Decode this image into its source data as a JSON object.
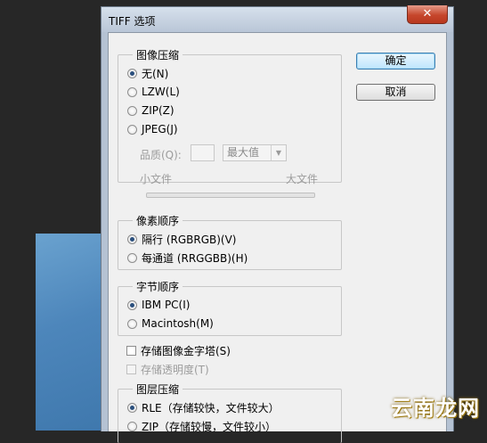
{
  "dialog": {
    "title": "TIFF 选项",
    "close_label": "✕"
  },
  "buttons": {
    "ok": "确定",
    "cancel": "取消"
  },
  "image_compression": {
    "label": "图像压缩",
    "options": [
      {
        "label": "无(N)",
        "selected": true
      },
      {
        "label": "LZW(L)",
        "selected": false
      },
      {
        "label": "ZIP(Z)",
        "selected": false
      },
      {
        "label": "JPEG(J)",
        "selected": false
      }
    ],
    "quality_label": "品质(Q):",
    "quality_value": "",
    "quality_select": "最大值",
    "small_file": "小文件",
    "large_file": "大文件"
  },
  "pixel_order": {
    "label": "像素顺序",
    "options": [
      {
        "label": "隔行 (RGBRGB)(V)",
        "selected": true
      },
      {
        "label": "每通道 (RRGGBB)(H)",
        "selected": false
      }
    ]
  },
  "byte_order": {
    "label": "字节顺序",
    "options": [
      {
        "label": "IBM PC(I)",
        "selected": true
      },
      {
        "label": "Macintosh(M)",
        "selected": false
      }
    ]
  },
  "checkboxes": {
    "pyramid": "存储图像金字塔(S)",
    "transparency": "存储透明度(T)"
  },
  "layer_compression": {
    "label": "图层压缩",
    "options": [
      {
        "label": "RLE（存储较快，文件较大）",
        "selected": true
      },
      {
        "label": "ZIP（存储较慢，文件较小）",
        "selected": false
      }
    ]
  },
  "watermark": "云南龙网"
}
